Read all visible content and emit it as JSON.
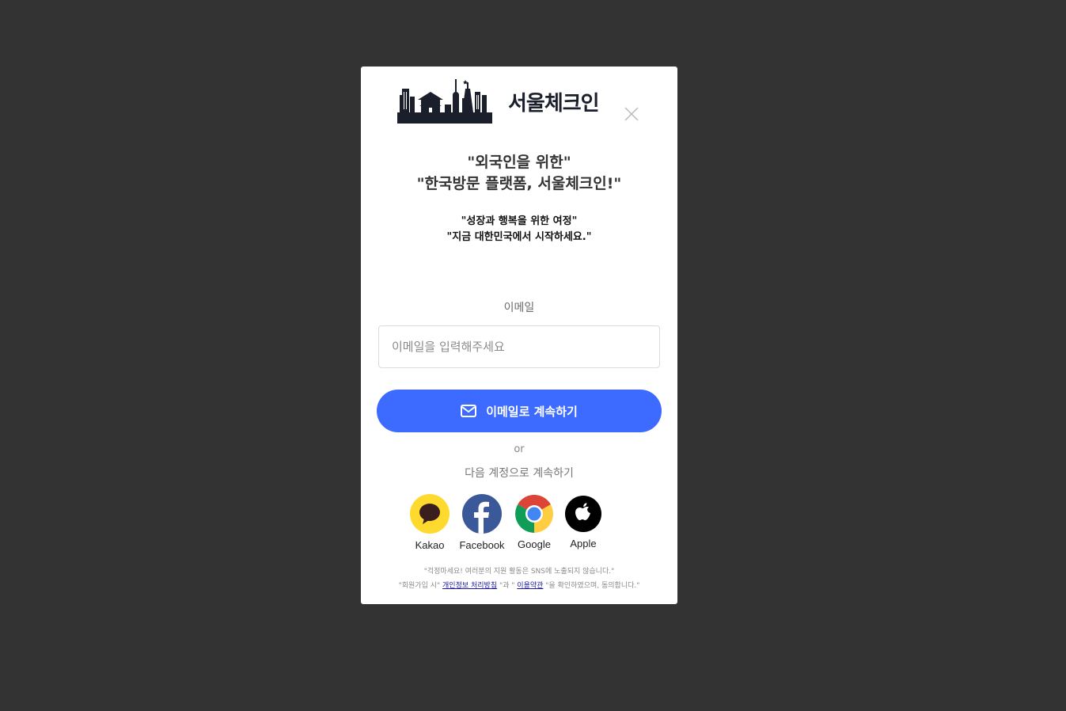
{
  "modal": {
    "brand_name": "서울체크인",
    "headline": [
      "\"외국인을 위한\"",
      "\"한국방문 플랫폼, 서울체크인!\""
    ],
    "subline": [
      "\"성장과 행복을 위한 여정\"",
      "\"지금 대한민국에서 시작하세요.\""
    ],
    "email_label": "이메일",
    "email_placeholder": "이메일을 입력해주세요",
    "email_value": "",
    "continue_button_label": "이메일로 계속하기",
    "or_text": "or",
    "alt_text": "다음 계정으로 계속하기",
    "social": [
      {
        "name": "Kakao",
        "color": "#FFDA2E",
        "icon": "kakao-icon"
      },
      {
        "name": "Facebook",
        "color": "#3B5998",
        "icon": "facebook-icon"
      },
      {
        "name": "Google",
        "color": "#4285F4",
        "icon": "chrome-icon"
      },
      {
        "name": "Apple",
        "color": "#000000",
        "icon": "apple-icon"
      }
    ],
    "footer": {
      "line1": "\"걱정마세요! 여러분의 지원 활동은 SNS에 노출되지 않습니다.\"",
      "line2_prefix": "\"회원가입 시\"",
      "privacy_link": "개인정보 처리방침",
      "line2_mid": "\"과 \"",
      "terms_link": "이용약관",
      "line2_suffix": "\"을 확인하였으며, 동의합니다.\""
    }
  },
  "colors": {
    "backdrop": "#333333",
    "primary": "#3D6AFF"
  }
}
